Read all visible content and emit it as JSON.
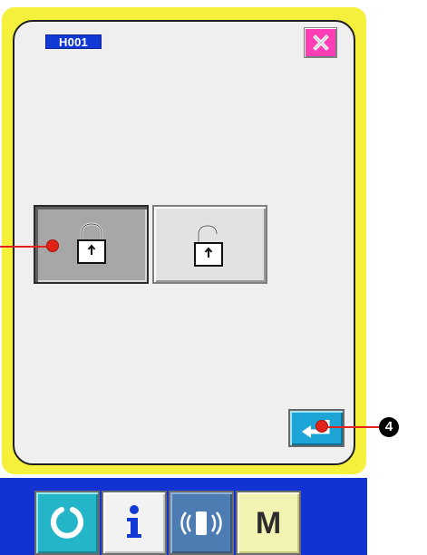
{
  "screen": {
    "code": "H001"
  },
  "buttons": {
    "close_icon": "close-icon",
    "lock_icon": "lock-closed-icon",
    "unlock_icon": "lock-open-icon",
    "enter_icon": "enter-arrow-icon"
  },
  "footer": {
    "ready_icon": "ready-icon",
    "info_icon": "info-icon",
    "communication_icon": "communication-icon",
    "mode_label": "M"
  },
  "callouts": {
    "enter_marker": "4"
  },
  "colors": {
    "panel_border": "#f4f03c",
    "panel_background": "#efefef",
    "screen_id_background": "#1238d6",
    "close_button": "#ff3eb5",
    "lock_selected": "#a7a7a7",
    "lock_unselected": "#e2e2e2",
    "enter_button": "#1da5d7",
    "footer_background": "#1332d2",
    "ready_button": "#24b6c8",
    "communication_button": "#4c7cb2",
    "mode_button": "#f2f3b2",
    "callout_red": "#e2231a"
  }
}
